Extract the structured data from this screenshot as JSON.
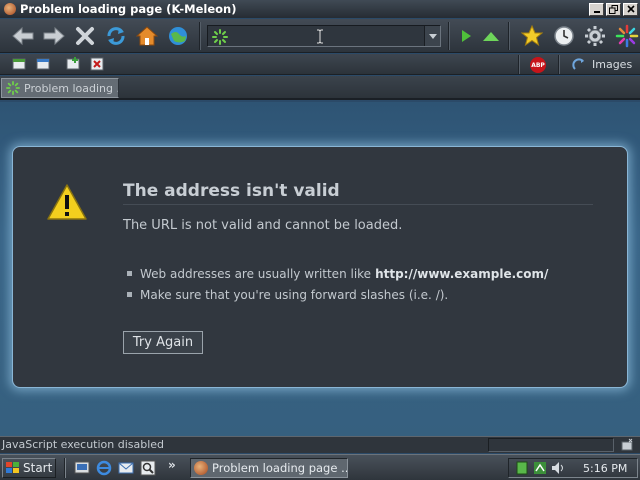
{
  "window": {
    "title": "Problem loading page (K-Meleon)",
    "controls": [
      "minimize",
      "restore",
      "close"
    ]
  },
  "toolbar": {
    "buttons": [
      "back-icon",
      "forward-icon",
      "stop-icon",
      "reload-icon",
      "home-icon",
      "go-icon"
    ],
    "url_value": "",
    "right_buttons": [
      "play-icon",
      "up-arrow-icon",
      "bookmarks-star-icon",
      "history-clock-icon",
      "settings-gear-icon",
      "kmeleon-logo-icon"
    ]
  },
  "toolbar2": {
    "images_label": "Images",
    "abp_label": "ABP"
  },
  "tabs": [
    {
      "label": "Problem loading ..."
    }
  ],
  "error": {
    "title": "The address isn't valid",
    "description": "The URL is not valid and cannot be loaded.",
    "bullets": [
      {
        "text": "Web addresses are usually written like",
        "bold": "http://www.example.com/"
      },
      {
        "text": "Make sure that you're using forward slashes (i.e. /).",
        "bold": ""
      }
    ],
    "try_again_label": "Try Again"
  },
  "status": {
    "text": "JavaScript execution disabled"
  },
  "taskbar": {
    "start_label": "Start",
    "more_label": "»",
    "task_label": "Problem loading page ...",
    "clock": "5:16 PM"
  },
  "colors": {
    "accent_glow": "#8ab6d6",
    "page_bg": "#36607f",
    "box_bg": "#31373f"
  }
}
